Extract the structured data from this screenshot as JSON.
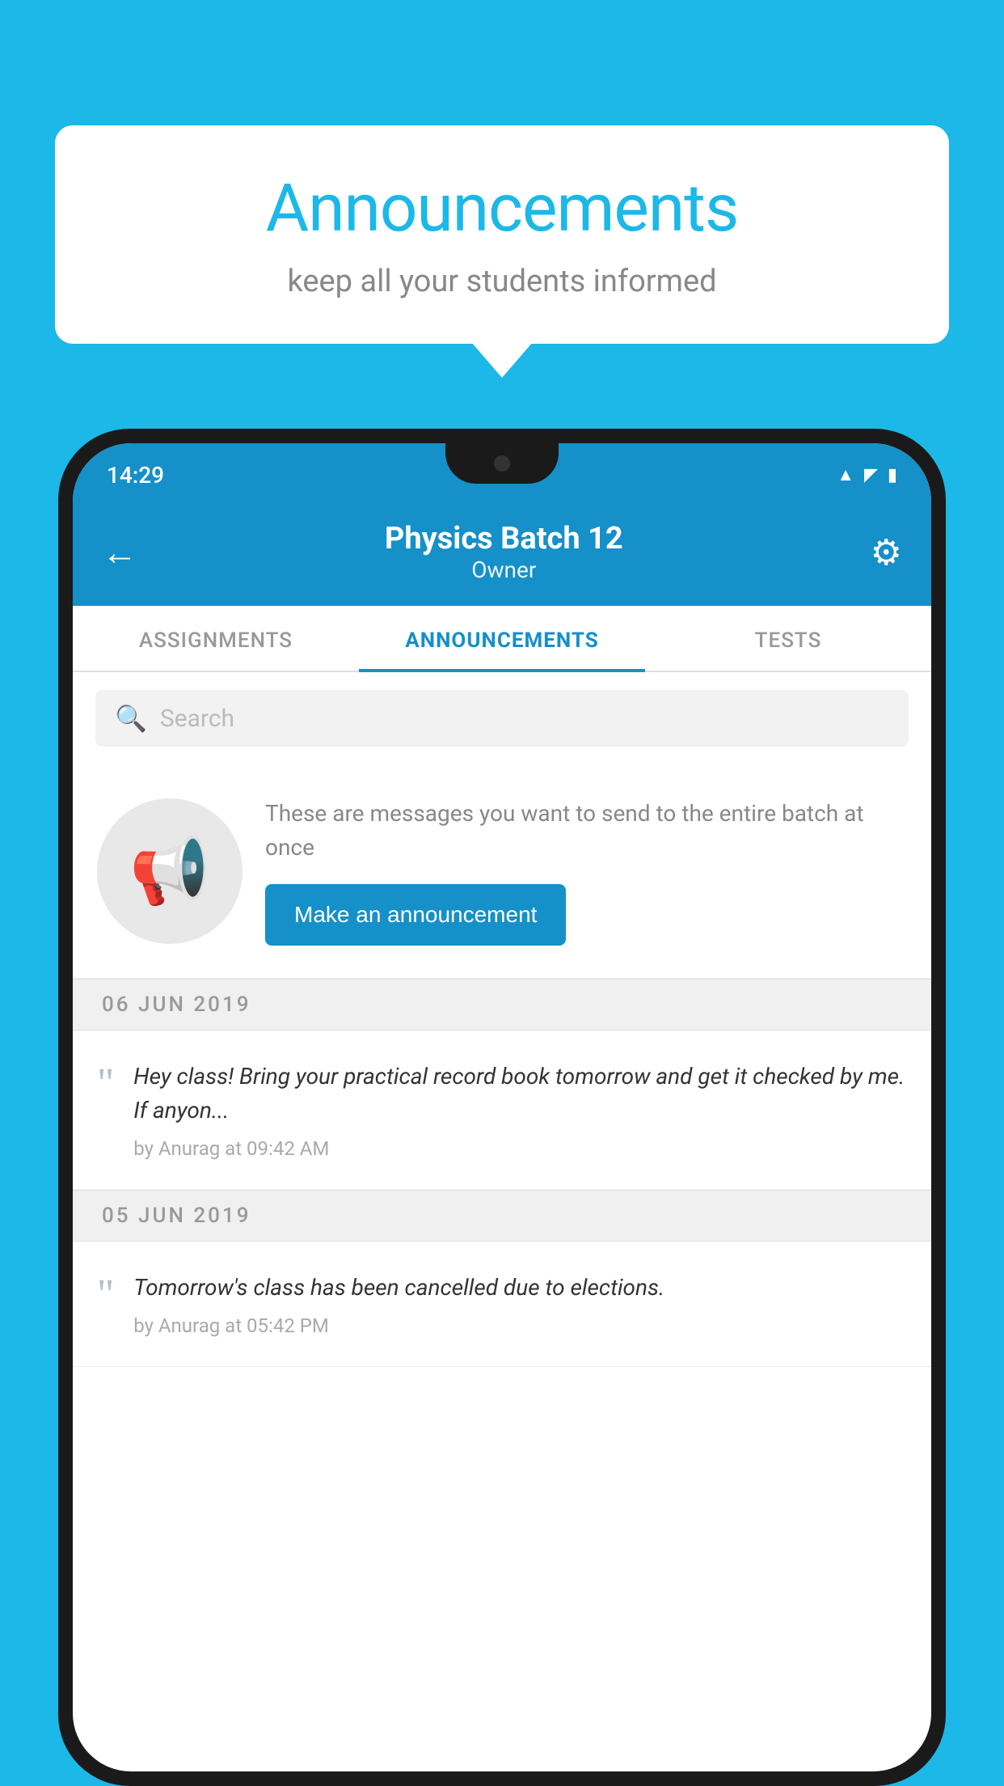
{
  "background_color": "#1BB8E8",
  "speech_bubble": {
    "title": "Announcements",
    "subtitle": "keep all your students informed"
  },
  "phone": {
    "status_bar": {
      "time": "14:29"
    },
    "header": {
      "title": "Physics Batch 12",
      "subtitle": "Owner",
      "back_label": "←",
      "gear_label": "⚙"
    },
    "tabs": [
      {
        "label": "ASSIGNMENTS",
        "active": false
      },
      {
        "label": "ANNOUNCEMENTS",
        "active": true
      },
      {
        "label": "TESTS",
        "active": false
      }
    ],
    "search": {
      "placeholder": "Search"
    },
    "promo": {
      "description": "These are messages you want to send to the entire batch at once",
      "button_label": "Make an announcement"
    },
    "date_groups": [
      {
        "date": "06  JUN  2019",
        "announcements": [
          {
            "text": "Hey class! Bring your practical record book tomorrow and get it checked by me. If anyon...",
            "meta": "by Anurag at 09:42 AM"
          }
        ]
      },
      {
        "date": "05  JUN  2019",
        "announcements": [
          {
            "text": "Tomorrow's class has been cancelled due to elections.",
            "meta": "by Anurag at 05:42 PM"
          }
        ]
      }
    ]
  }
}
